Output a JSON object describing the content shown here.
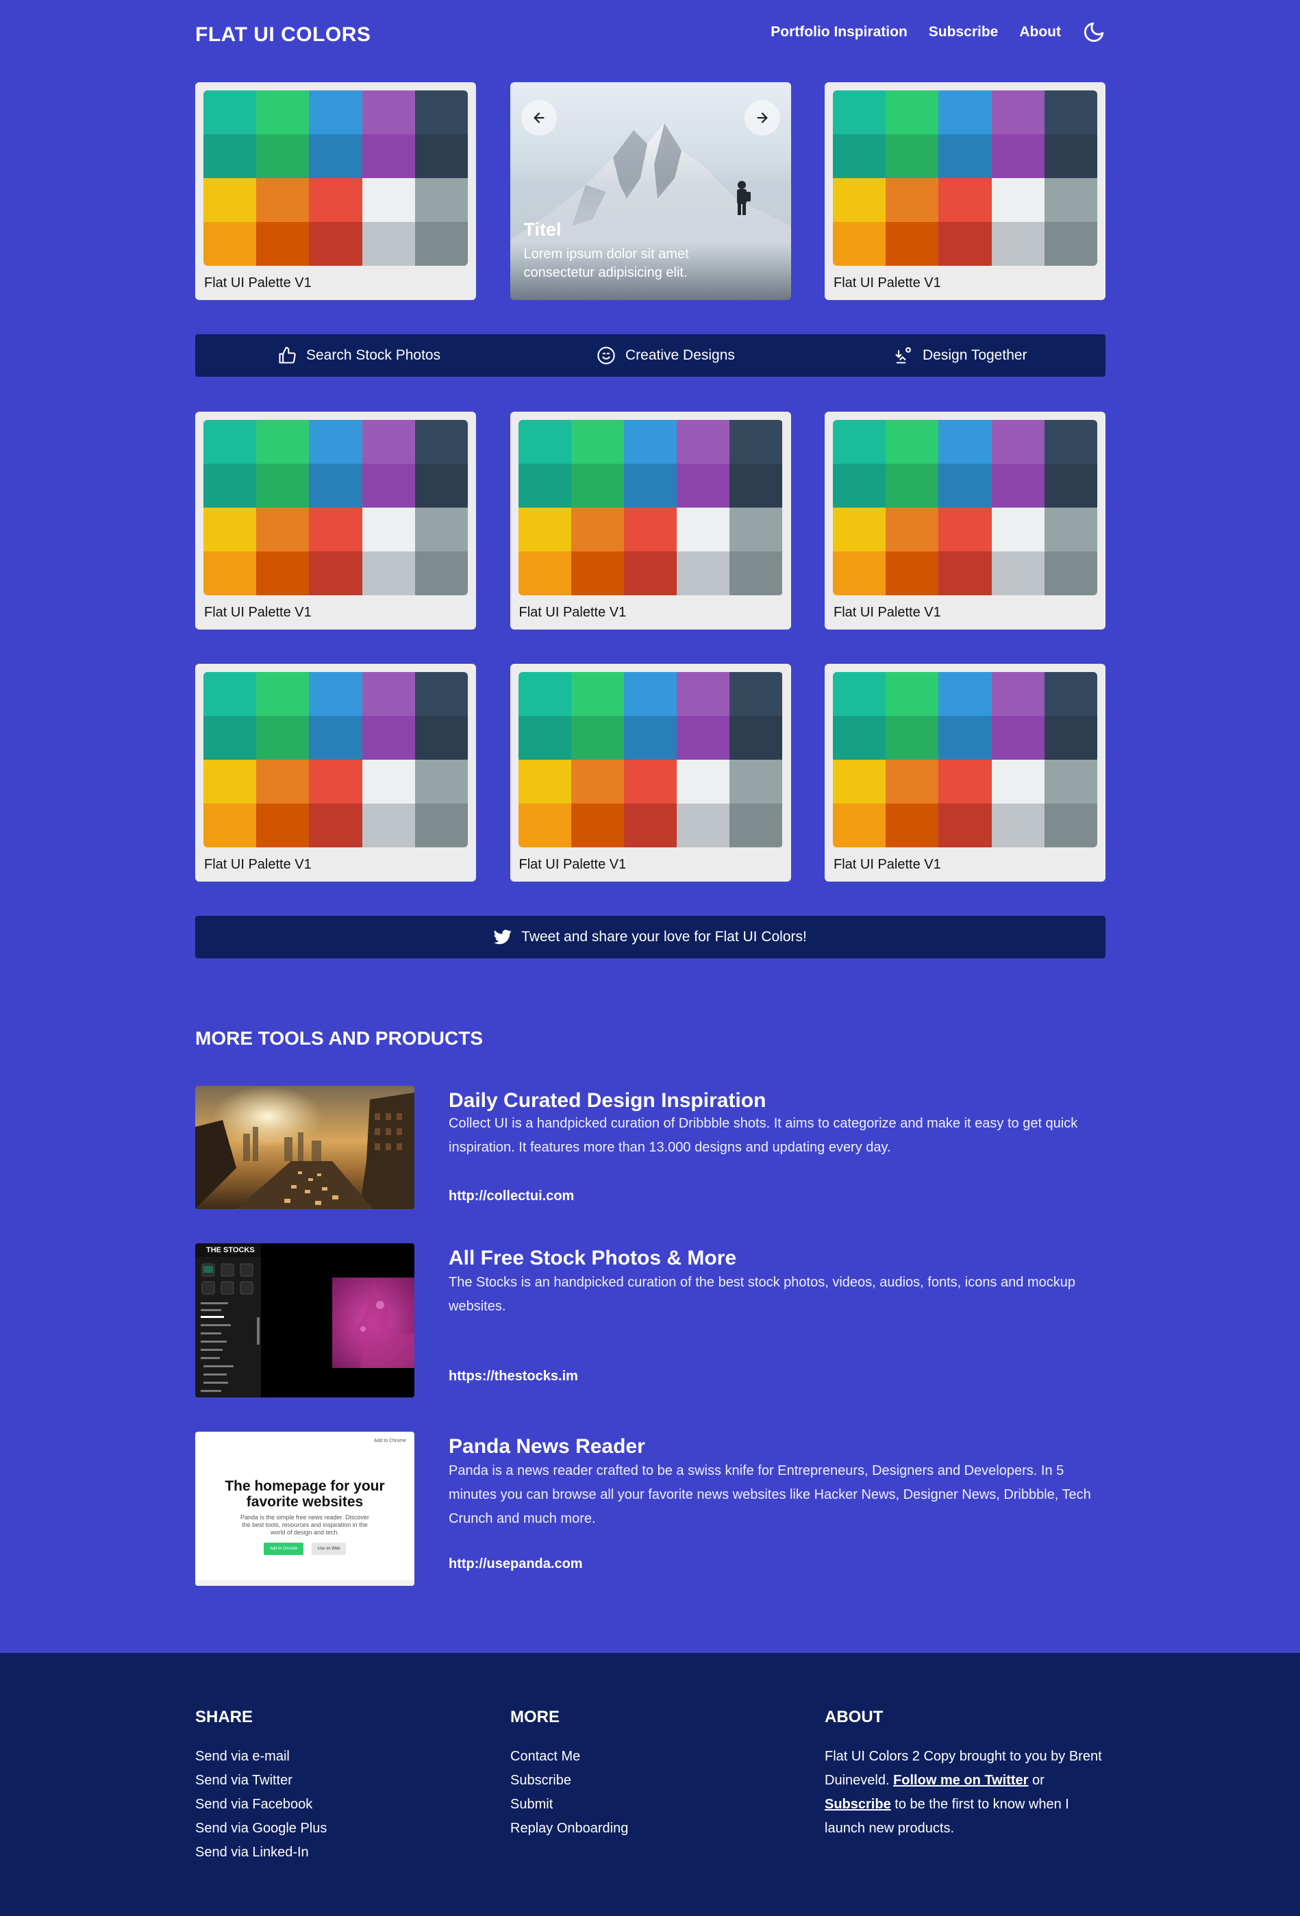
{
  "header": {
    "logo": "FLAT UI COLORS",
    "nav": [
      "Portfolio Inspiration",
      "Subscribe",
      "About"
    ],
    "theme_icon": "moon-icon"
  },
  "palette_colors": [
    "#1abc9c",
    "#2ecc71",
    "#3498db",
    "#9b59b6",
    "#34495e",
    "#16a085",
    "#27ae60",
    "#2980b9",
    "#8e44ad",
    "#2c3e50",
    "#f1c40f",
    "#e67e22",
    "#e74c3c",
    "#ecf0f1",
    "#95a5a6",
    "#f39c12",
    "#d35400",
    "#c0392b",
    "#bdc3c7",
    "#7f8c8d"
  ],
  "cards": {
    "top_left": "Flat UI Palette V1",
    "top_right": "Flat UI Palette V1",
    "grid": [
      "Flat UI Palette V1",
      "Flat UI Palette V1",
      "Flat UI Palette V1",
      "Flat UI Palette V1",
      "Flat UI Palette V1",
      "Flat UI Palette V1"
    ]
  },
  "hero": {
    "title": "Titel",
    "text": "Lorem ipsum dolor sit amet consectetur adipisicing elit."
  },
  "features": [
    {
      "label": "Search Stock Photos",
      "icon": "thumbs-up-icon"
    },
    {
      "label": "Creative Designs",
      "icon": "smile-icon"
    },
    {
      "label": "Design Together",
      "icon": "people-icon"
    }
  ],
  "tweet_bar": {
    "label": "Tweet and share your love for Flat UI Colors!",
    "icon": "twitter-icon"
  },
  "more_tools": {
    "title": "MORE TOOLS AND PRODUCTS",
    "products": [
      {
        "title": "Daily Curated Design Inspiration",
        "desc": "Collect UI is a handpicked curation of Dribbble shots. It aims to categorize and make it easy to get quick inspiration. It features more than 13.000 designs and updating every day.",
        "link": "http://collectui.com"
      },
      {
        "title": "All Free Stock Photos & More",
        "desc": "The Stocks is an handpicked curation of the best stock photos, videos, audios, fonts, icons and mockup websites.",
        "link": "https://thestocks.im",
        "thumb_label": "THE STOCKS"
      },
      {
        "title": "Panda News Reader",
        "desc": "Panda is a news reader crafted to be a swiss knife for Entrepreneurs, Designers and Developers. In 5 minutes you can browse all your favorite news websites like Hacker News, Designer News, Dribbble, Tech Crunch and much more.",
        "link": "http://usepanda.com",
        "thumb_heading": "The homepage for your favorite websites",
        "thumb_sub": "Panda is the simple free news reader. Discover the best tools, resources and inspiration in the world of design and tech.",
        "thumb_btn1": "Add to Chrome",
        "thumb_btn2": "Use on Web",
        "thumb_top": "Add to Chrome"
      }
    ]
  },
  "footer": {
    "share": {
      "title": "SHARE",
      "items": [
        "Send via e-mail",
        "Send via Twitter",
        "Send via Facebook",
        "Send via Google Plus",
        "Send via Linked-In"
      ]
    },
    "more": {
      "title": "MORE",
      "items": [
        "Contact Me",
        "Subscribe",
        "Submit",
        "Replay Onboarding"
      ]
    },
    "about": {
      "title": "ABOUT",
      "text1": "Flat UI Colors 2 Copy brought to you by Brent Duineveld. ",
      "link1": "Follow me on Twitter",
      "text2": " or ",
      "link2": "Subscribe",
      "text3": " to be the first to know when I launch new products."
    }
  }
}
